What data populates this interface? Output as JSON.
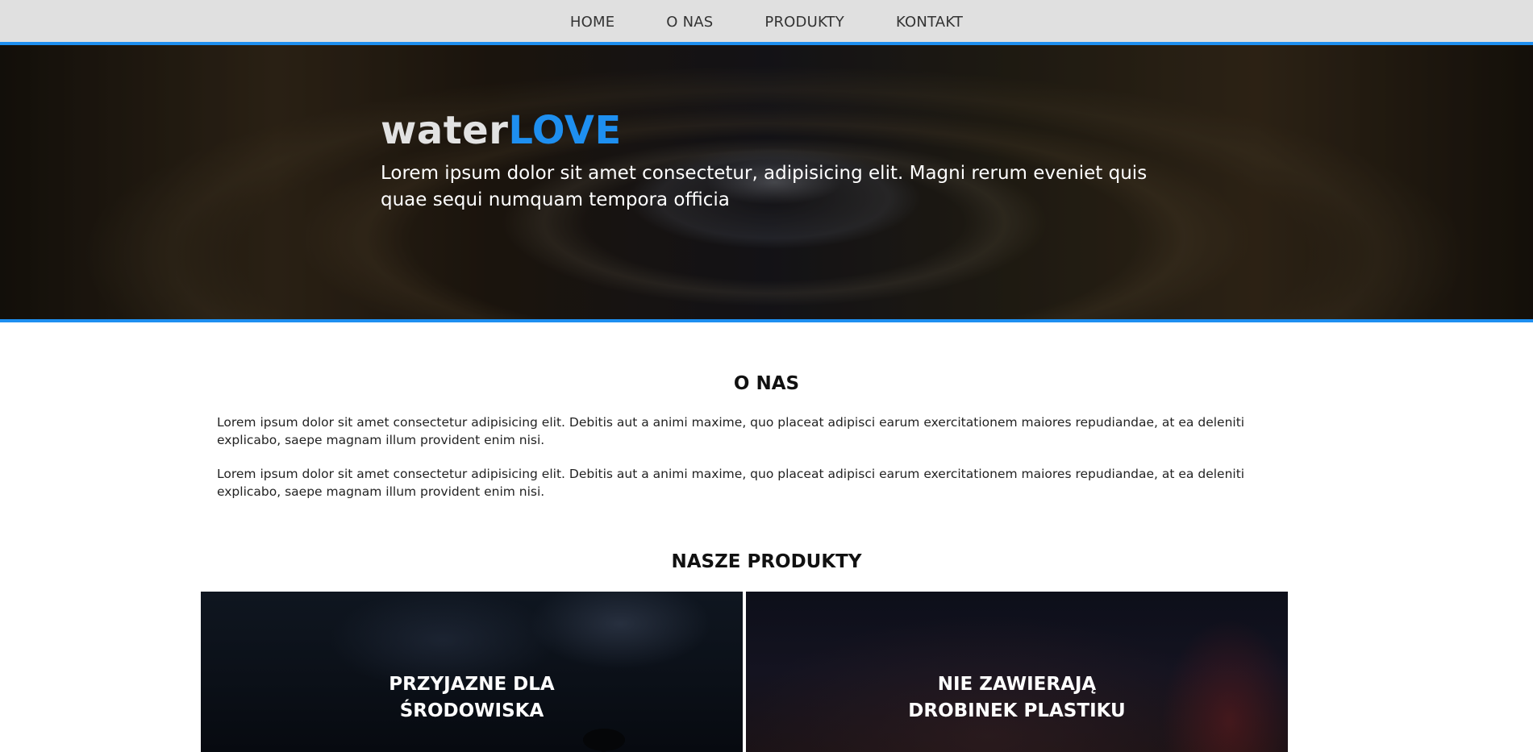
{
  "nav": {
    "items": [
      {
        "label": "HOME"
      },
      {
        "label": "O NAS"
      },
      {
        "label": "PRODUKTY"
      },
      {
        "label": "KONTAKT"
      }
    ]
  },
  "hero": {
    "title_part1": "water",
    "title_part2": "LOVE",
    "subtitle": "Lorem ipsum dolor sit amet consectetur, adipisicing elit. Magni rerum eveniet quis quae sequi numquam tempora officia"
  },
  "about": {
    "title": "O NAS",
    "paragraphs": [
      "Lorem ipsum dolor sit amet consectetur adipisicing elit. Debitis aut a animi maxime, quo placeat adipisci earum exercitationem maiores repudiandae, at ea deleniti explicabo, saepe magnam illum provident enim nisi.",
      "Lorem ipsum dolor sit amet consectetur adipisicing elit. Debitis aut a animi maxime, quo placeat adipisci earum exercitationem maiores repudiandae, at ea deleniti explicabo, saepe magnam illum provident enim nisi."
    ]
  },
  "products": {
    "title": "NASZE PRODUKTY",
    "cards": [
      {
        "label": "PRZYJAZNE DLA ŚRODOWISKA"
      },
      {
        "label": "NIE ZAWIERAJĄ DROBINEK PLASTIKU"
      }
    ]
  },
  "colors": {
    "accent": "#1e8ff0",
    "nav_bg": "#e0e0e0"
  }
}
